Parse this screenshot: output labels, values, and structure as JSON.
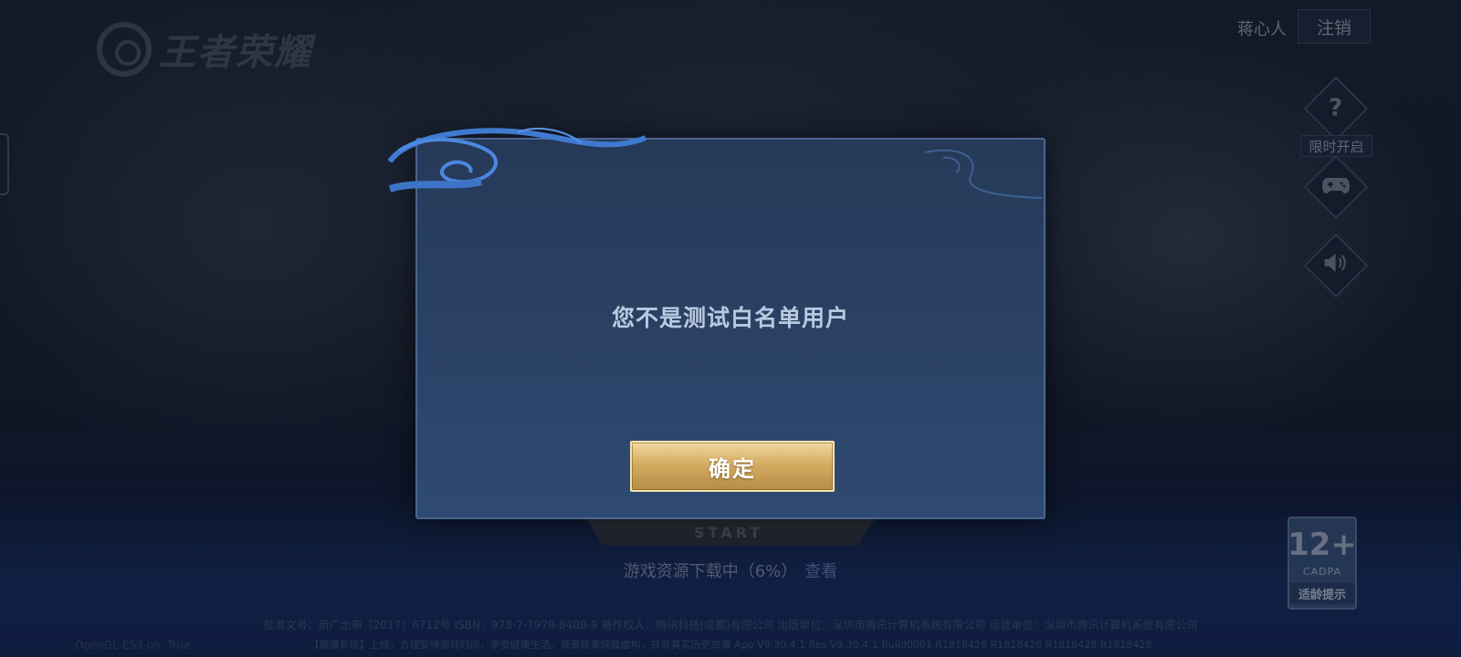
{
  "header": {
    "logo_text": "王者荣耀",
    "user_name": "蒋心人",
    "logout_label": "注销"
  },
  "side": {
    "help_icon": "question-icon",
    "limit_label": "限时开启",
    "gamepad_icon": "gamepad-icon",
    "sound_icon": "speaker-icon"
  },
  "dialog": {
    "message": "您不是测试白名单用户",
    "confirm_label": "确定"
  },
  "start": {
    "label": "START"
  },
  "download": {
    "text": "游戏资源下载中（6%）",
    "view_label": "查看",
    "progress": 0.06
  },
  "rating": {
    "age": "12+",
    "org": "CADPA",
    "tip": "适龄提示"
  },
  "footer": {
    "line1": "批准文号：新广出审［2017］6712号 ISBN：978-7-7979-8408-9 著作权人：腾讯科技(成都)有限公司 出版单位：深圳市腾讯计算机系统有限公司 运营单位：深圳市腾讯计算机系统有限公司",
    "line2": "【健康系统】上线，合理安排游戏时间，享受健康生活。背景故事纯属虚构，并非真实历史故事 App V9.30.4.1 Res V9.30.4.1 Build0001 R1818428 R1818428 R1818428 R1818428",
    "opengl": "OpenGL ES3 on: True"
  },
  "colors": {
    "dialog_bg": "#2b4266",
    "button_gold": "#d4ac62",
    "message_text": "#b9c9e0"
  }
}
